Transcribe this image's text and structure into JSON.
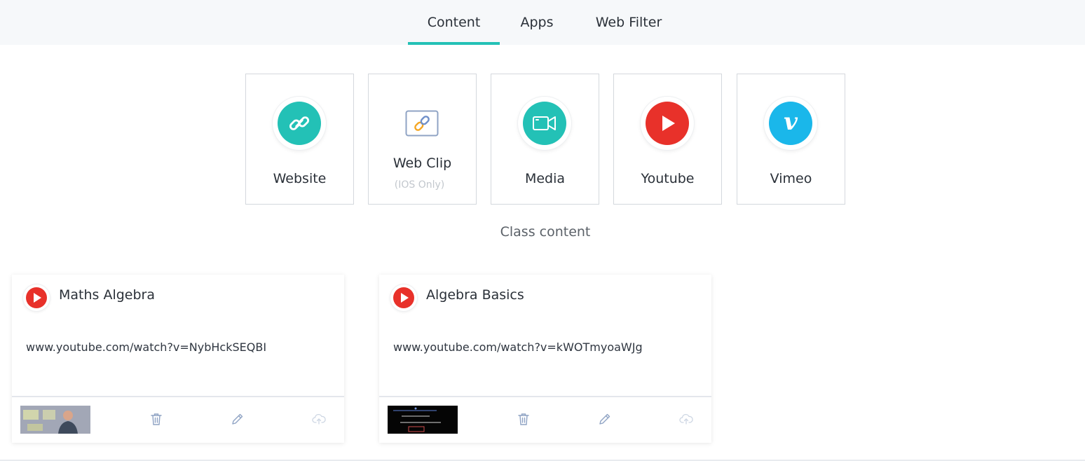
{
  "tabs": {
    "content": "Content",
    "apps": "Apps",
    "web_filter": "Web Filter"
  },
  "content_types": {
    "website": "Website",
    "webclip": "Web Clip",
    "webclip_sub": "(IOS Only)",
    "media": "Media",
    "youtube": "Youtube",
    "vimeo": "Vimeo"
  },
  "section_title": "Class content",
  "cards": [
    {
      "title": "Maths Algebra",
      "url": "www.youtube.com/watch?v=NybHckSEQBI",
      "icon": "youtube-icon"
    },
    {
      "title": "Algebra Basics",
      "url": "www.youtube.com/watch?v=kWOTmyoaWJg",
      "icon": "youtube-icon"
    }
  ],
  "colors": {
    "accent": "#23c1b6",
    "youtube_red": "#e8312a",
    "vimeo_blue": "#1ab7ea",
    "icon_gray": "#9aa8bd"
  }
}
